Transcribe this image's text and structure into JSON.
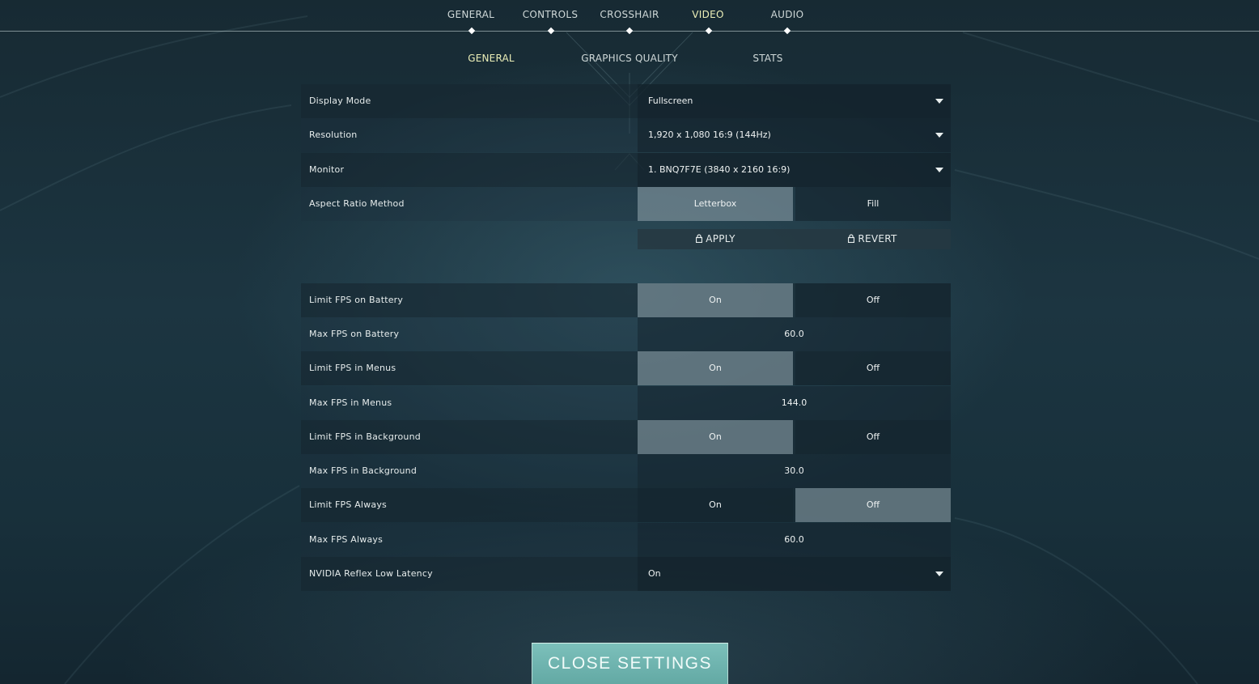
{
  "top_tabs": [
    {
      "label": "GENERAL",
      "active": false
    },
    {
      "label": "CONTROLS",
      "active": false
    },
    {
      "label": "CROSSHAIR",
      "active": false
    },
    {
      "label": "VIDEO",
      "active": true
    },
    {
      "label": "AUDIO",
      "active": false
    }
  ],
  "sub_tabs": [
    {
      "label": "GENERAL",
      "active": true
    },
    {
      "label": "GRAPHICS QUALITY",
      "active": false
    },
    {
      "label": "STATS",
      "active": false
    }
  ],
  "display_settings": {
    "display_mode": {
      "label": "Display Mode",
      "value": "Fullscreen"
    },
    "resolution": {
      "label": "Resolution",
      "value": "1,920 x 1,080 16:9 (144Hz)"
    },
    "monitor": {
      "label": "Monitor",
      "value": "1. BNQ7F7E (3840 x  2160 16:9)"
    },
    "aspect_ratio": {
      "label": "Aspect Ratio Method",
      "options": [
        "Letterbox",
        "Fill"
      ],
      "selected": "Letterbox"
    }
  },
  "actions": {
    "apply_label": "APPLY",
    "revert_label": "REVERT",
    "icon": "lock-icon"
  },
  "fps_settings": {
    "limit_battery": {
      "label": "Limit FPS on Battery",
      "on": "On",
      "off": "Off",
      "selected": "On"
    },
    "max_battery": {
      "label": "Max FPS on Battery",
      "value": "60.0"
    },
    "limit_menus": {
      "label": "Limit FPS in Menus",
      "on": "On",
      "off": "Off",
      "selected": "On"
    },
    "max_menus": {
      "label": "Max FPS in Menus",
      "value": "144.0"
    },
    "limit_background": {
      "label": "Limit FPS in Background",
      "on": "On",
      "off": "Off",
      "selected": "On"
    },
    "max_background": {
      "label": "Max FPS in Background",
      "value": "30.0"
    },
    "limit_always": {
      "label": "Limit FPS Always",
      "on": "On",
      "off": "Off",
      "selected": "Off"
    },
    "max_always": {
      "label": "Max FPS Always",
      "value": "60.0"
    },
    "nvidia_reflex": {
      "label": "NVIDIA Reflex Low Latency",
      "value": "On"
    }
  },
  "close_button": {
    "label": "CLOSE SETTINGS"
  },
  "colors": {
    "active_tab": "#ecefb8",
    "close_button": "#6fb5b0",
    "selected_toggle": "#8aa0a8"
  }
}
